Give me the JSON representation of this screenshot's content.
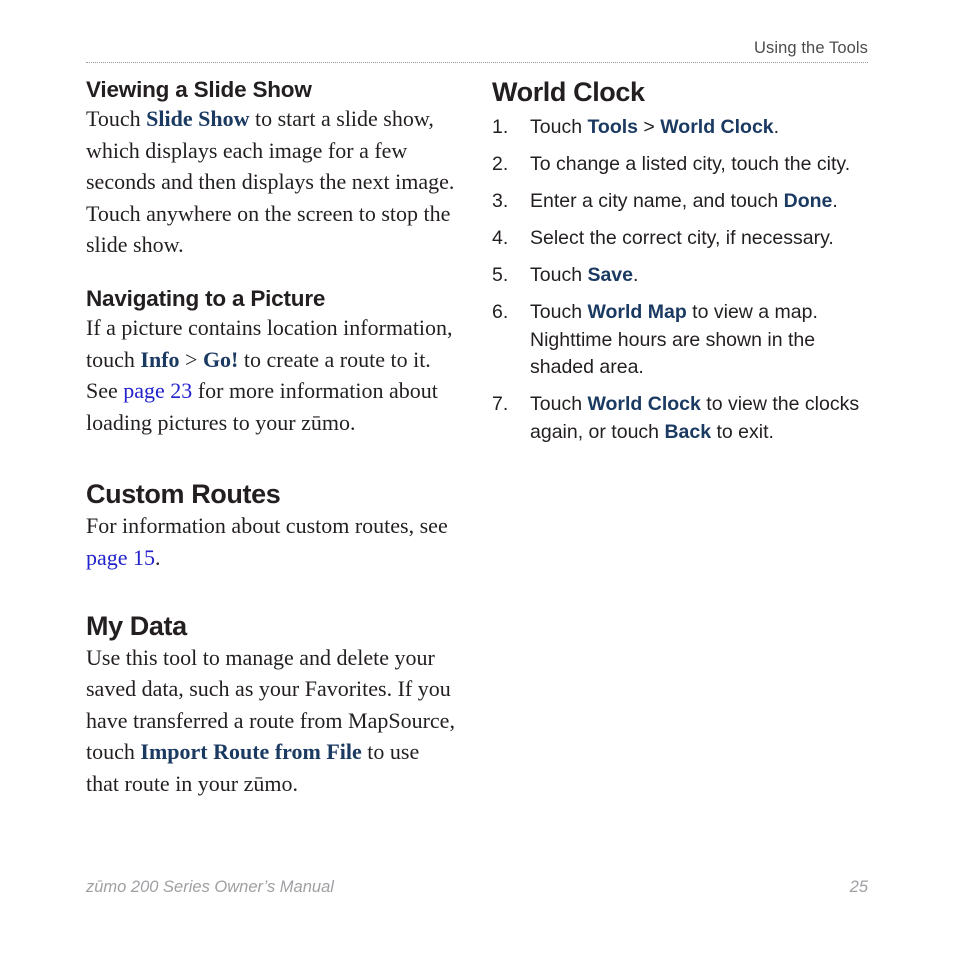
{
  "header": {
    "title": "Using the Tools"
  },
  "left_column": {
    "slide_show": {
      "heading": "Viewing a Slide Show",
      "text_1": "Touch ",
      "ui_1": "Slide Show",
      "text_2": " to start a slide show, which displays each image for a few seconds and then displays the next image. Touch anywhere on the screen to stop the slide show."
    },
    "navigating_picture": {
      "heading": "Navigating to a Picture",
      "text_1": "If a picture contains location information, touch ",
      "ui_1": "Info",
      "sep_1": " > ",
      "ui_2": "Go!",
      "text_2": " to create a route to it. See ",
      "link_1": "page 23",
      "text_3": " for more information about loading pictures to your zūmo."
    },
    "custom_routes": {
      "heading": "Custom Routes",
      "text_1": "For information about custom routes, see ",
      "link_1": "page 15",
      "text_2": "."
    },
    "my_data": {
      "heading": "My Data",
      "text_1": "Use this tool to manage and delete your saved data, such as your Favorites. If you have transferred a route from MapSource, touch ",
      "ui_1": "Import Route from File",
      "text_2": " to use that route in your zūmo."
    }
  },
  "right_column": {
    "world_clock": {
      "heading": "World Clock",
      "steps": [
        {
          "num": "1.",
          "parts": [
            {
              "kind": "text",
              "value": "Touch "
            },
            {
              "kind": "ui",
              "value": "Tools"
            },
            {
              "kind": "text",
              "value": " > "
            },
            {
              "kind": "ui",
              "value": "World Clock"
            },
            {
              "kind": "text",
              "value": "."
            }
          ]
        },
        {
          "num": "2.",
          "parts": [
            {
              "kind": "text",
              "value": "To change a listed city, touch the city."
            }
          ]
        },
        {
          "num": "3.",
          "parts": [
            {
              "kind": "text",
              "value": "Enter a city name, and touch "
            },
            {
              "kind": "ui",
              "value": "Done"
            },
            {
              "kind": "text",
              "value": "."
            }
          ]
        },
        {
          "num": "4.",
          "parts": [
            {
              "kind": "text",
              "value": "Select the correct city, if necessary."
            }
          ]
        },
        {
          "num": "5.",
          "parts": [
            {
              "kind": "text",
              "value": "Touch "
            },
            {
              "kind": "ui",
              "value": "Save"
            },
            {
              "kind": "text",
              "value": "."
            }
          ]
        },
        {
          "num": "6.",
          "parts": [
            {
              "kind": "text",
              "value": "Touch "
            },
            {
              "kind": "ui",
              "value": "World Map"
            },
            {
              "kind": "text",
              "value": " to view a map. Nighttime hours are shown in the shaded area."
            }
          ]
        },
        {
          "num": "7.",
          "parts": [
            {
              "kind": "text",
              "value": "Touch "
            },
            {
              "kind": "ui",
              "value": "World Clock"
            },
            {
              "kind": "text",
              "value": " to view the clocks again, or touch "
            },
            {
              "kind": "ui",
              "value": "Back"
            },
            {
              "kind": "text",
              "value": " to exit."
            }
          ]
        }
      ]
    }
  },
  "footer": {
    "manual_title": "zūmo 200 Series Owner’s Manual",
    "page_number": "25"
  },
  "colors": {
    "ui_label_navy": "#1b3a62",
    "cross_reference_blue": "#2222cc",
    "body_text": "#231f20",
    "header_gray": "#4c4c4c",
    "footer_gray": "#a0a0a4",
    "rule_gray": "#9b9b9b",
    "page_background": "#ffffff"
  }
}
